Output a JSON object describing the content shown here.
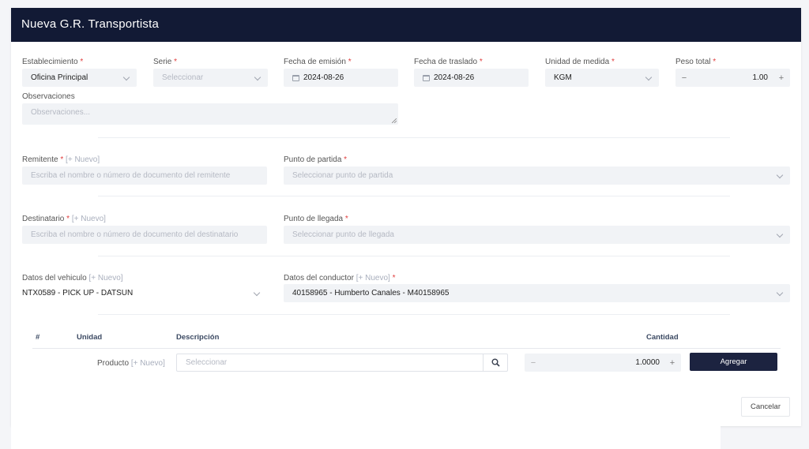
{
  "header": {
    "title": "Nueva G.R. Transportista"
  },
  "labels": {
    "establecimiento": "Establecimiento",
    "serie": "Serie",
    "fecha_emision": "Fecha de emisión",
    "fecha_traslado": "Fecha de traslado",
    "unidad_medida": "Unidad de medida",
    "peso_total": "Peso total",
    "observaciones": "Observaciones",
    "remitente": "Remitente",
    "punto_partida": "Punto de partida",
    "destinatario": "Destinatario",
    "punto_llegada": "Punto de llegada",
    "datos_vehiculo": "Datos del vehiculo",
    "datos_conductor": "Datos del conductor",
    "required_mark": "*",
    "nuevo_link": "[+ Nuevo]"
  },
  "fields": {
    "establecimiento_value": "Oficina Principal",
    "serie_placeholder": "Seleccionar",
    "fecha_emision_value": "2024-08-26",
    "fecha_traslado_value": "2024-08-26",
    "unidad_medida_value": "KGM",
    "peso_total_value": "1.00",
    "observaciones_placeholder": "Observaciones...",
    "remitente_placeholder": "Escriba el nombre o número de documento del remitente",
    "punto_partida_placeholder": "Seleccionar punto de partida",
    "destinatario_placeholder": "Escriba el nombre o número de documento del destinatario",
    "punto_llegada_placeholder": "Seleccionar punto de llegada",
    "vehiculo_value": "NTX0589 - PICK UP - DATSUN",
    "conductor_value": "40158965 - Humberto Canales - M40158965"
  },
  "table": {
    "headers": {
      "num": "#",
      "unidad": "Unidad",
      "descripcion": "Descripción",
      "cantidad": "Cantidad"
    },
    "producto_label": "Producto",
    "producto_placeholder": "Seleccionar",
    "cantidad_value": "1.0000",
    "agregar_label": "Agregar"
  },
  "stepper": {
    "minus": "−",
    "plus": "+"
  },
  "footer": {
    "cancel_label": "Cancelar"
  },
  "colors": {
    "header_bg": "#121a35",
    "primary_button": "#1c2340",
    "required": "#e03d3d"
  },
  "icons": [
    "calendar-icon",
    "chevron-down-icon",
    "search-icon",
    "resize-handle-icon"
  ]
}
